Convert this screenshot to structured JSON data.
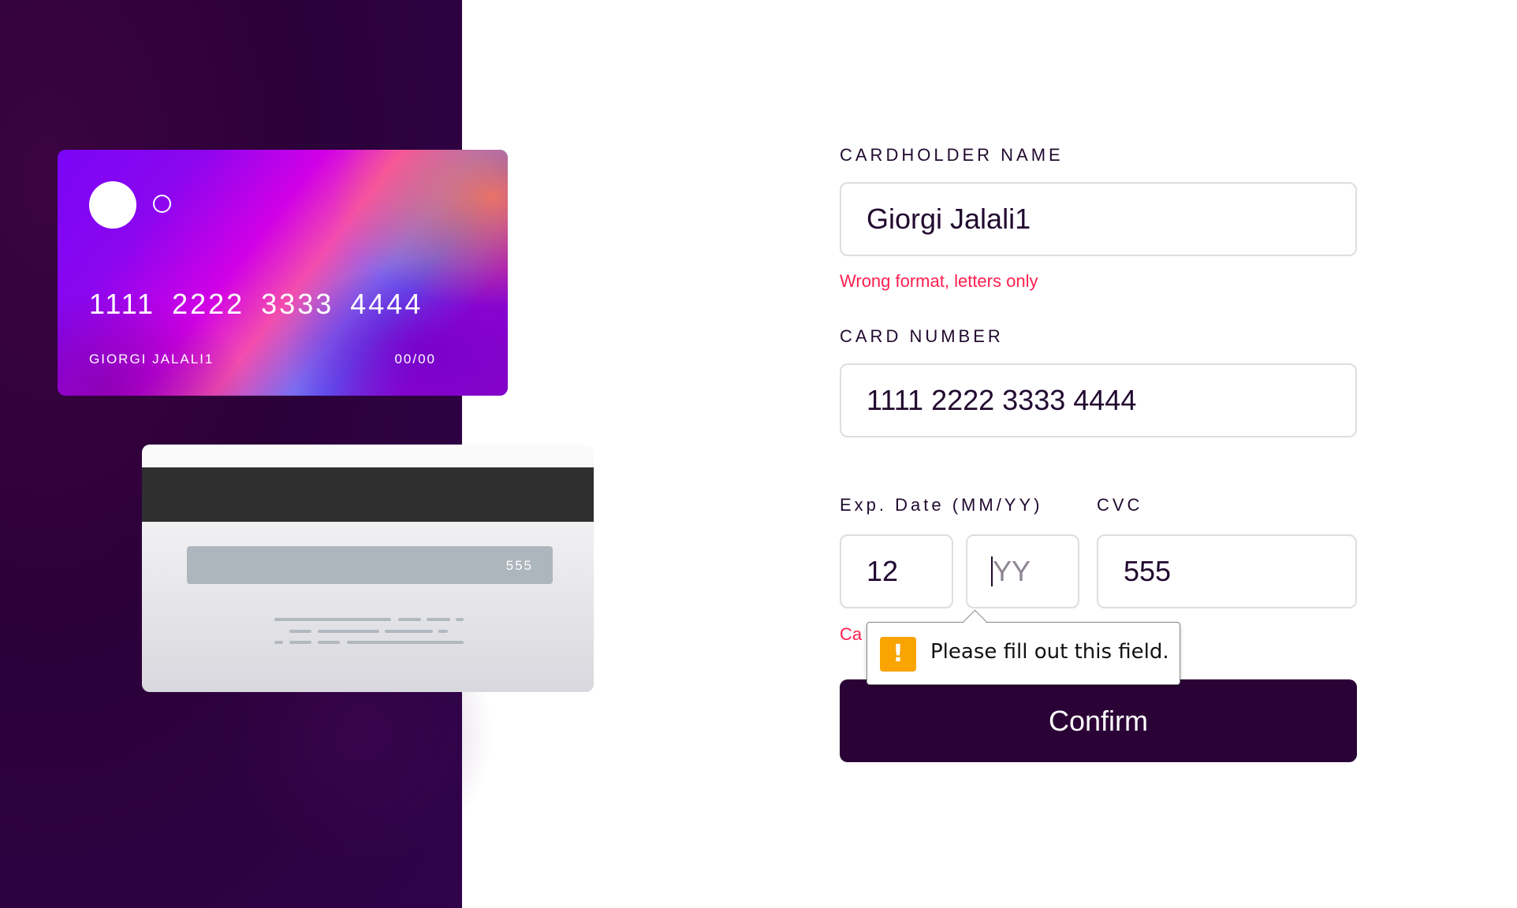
{
  "card_preview": {
    "front": {
      "number": "1111 2222 3333 4444",
      "name": "GIORGI JALALI1",
      "expiry": "00/00"
    },
    "back": {
      "cvc": "555"
    }
  },
  "form": {
    "cardholder": {
      "label": "CARDHOLDER NAME",
      "value": "Giorgi Jalali1",
      "error": "Wrong format, letters only"
    },
    "card_number": {
      "label": "CARD NUMBER",
      "value": "1111 2222 3333 4444"
    },
    "exp_date": {
      "label": "Exp. Date (MM/YY)",
      "month_value": "12",
      "year_value": "",
      "year_placeholder": "YY",
      "error_partial": "Ca"
    },
    "cvc": {
      "label": "CVC",
      "value": "555"
    },
    "confirm_label": "Confirm"
  },
  "validation_tooltip": {
    "icon": "warning-icon",
    "message": "Please fill out this field."
  },
  "colors": {
    "dark_purple": "#21092f",
    "button": "#2b0236",
    "error": "#ff2050",
    "warning": "#f9a400"
  }
}
